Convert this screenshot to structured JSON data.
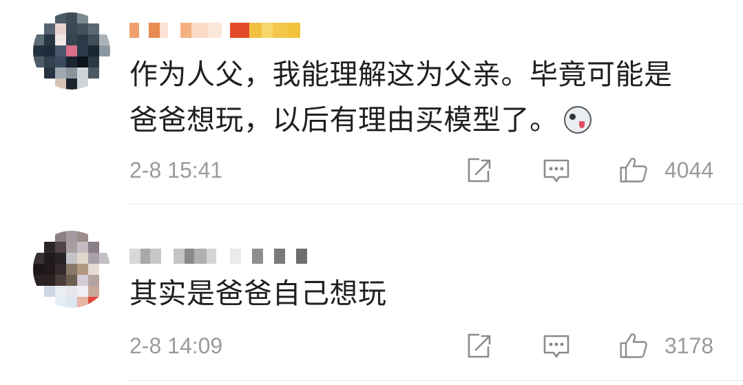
{
  "comments": [
    {
      "text_line1": "作为人父，我能理解这为父亲。毕竟可能是",
      "text_line2": "爸爸想玩，以后有理由买模型了。",
      "emoji": "husky-emoji",
      "time": "2-8 15:41",
      "likes": "4044"
    },
    {
      "text_line1": "其实是爸爸自己想玩",
      "time": "2-8 14:09",
      "likes": "3178"
    }
  ],
  "colors": {
    "text": "#1f1f1f",
    "meta": "#9a9a9a",
    "divider": "#e4e4e4"
  }
}
